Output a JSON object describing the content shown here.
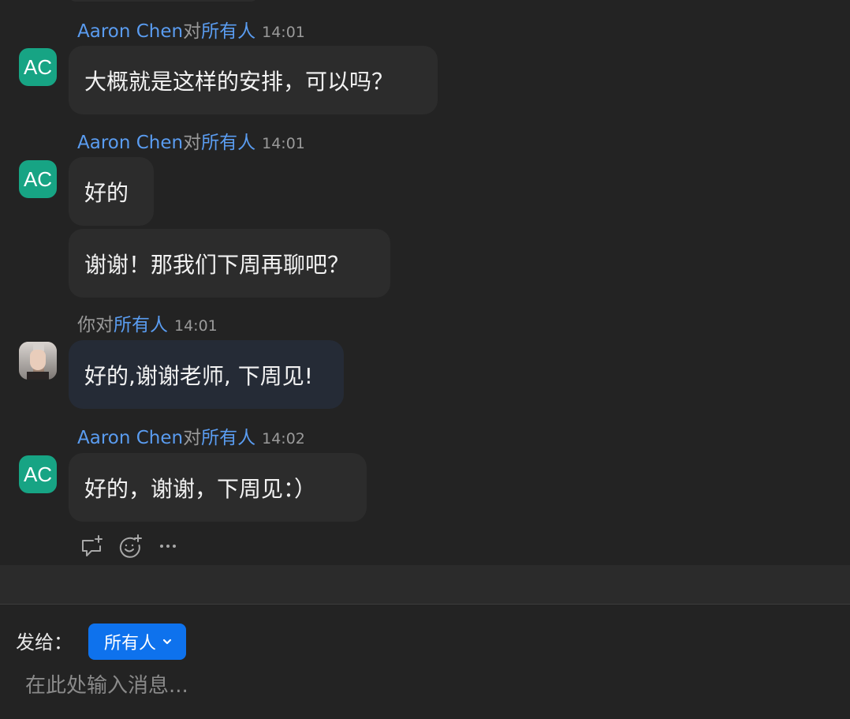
{
  "messages": [
    {
      "sender": "Aaron Chen",
      "connector": "对",
      "target": "所有人",
      "time": "14:01",
      "avatar_initials": "AC",
      "bubbles": [
        "大概就是这样的安排，可以吗？"
      ]
    },
    {
      "sender": "Aaron Chen",
      "connector": "对",
      "target": "所有人",
      "time": "14:01",
      "avatar_initials": "AC",
      "bubbles": [
        "好的",
        "谢谢！那我们下周再聊吧？"
      ]
    },
    {
      "sender": "你",
      "connector": "对",
      "target": "所有人",
      "time": "14:01",
      "avatar_initials": "",
      "bubbles": [
        "好的,谢谢老师, 下周见!"
      ]
    },
    {
      "sender": "Aaron Chen",
      "connector": "对",
      "target": "所有人",
      "time": "14:02",
      "avatar_initials": "AC",
      "bubbles": [
        "好的，谢谢，下周见：）"
      ]
    }
  ],
  "message_actions": {
    "icons": [
      "reply-add-icon",
      "emoji-add-icon",
      "more-icon"
    ]
  },
  "composer": {
    "send_to_label": "发给：",
    "recipient": "所有人",
    "input_value": "",
    "input_placeholder": "在此处输入消息..."
  },
  "colors": {
    "background": "#232323",
    "bubble": "#2c2c2c",
    "own_bubble": "#252b36",
    "sender_name": "#5a9cf0",
    "avatar": "#17a484",
    "recipient_button": "#0e72ed",
    "muted_text": "#9a9a9a"
  }
}
